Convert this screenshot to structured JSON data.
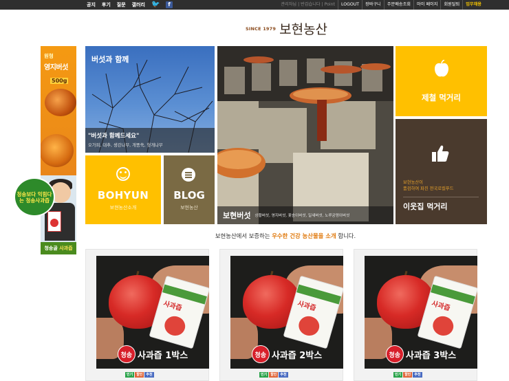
{
  "topnav": {
    "links": [
      "공지",
      "후기",
      "질문",
      "갤러리"
    ],
    "right_links": [
      "관리자님 | 반갑습니다 | Point",
      "LOGOUT",
      "장바구니",
      "주문배송조회",
      "마이 페이지",
      "회원탈퇴",
      "업무채용"
    ]
  },
  "logo": {
    "since": "SINCE 1979",
    "name": "보현농산"
  },
  "left_banner": {
    "tag": "원형",
    "title": "영지버섯",
    "weight": "500g",
    "circle_text": "청송보다 익힘다는 청송사과즙",
    "bottom_label_a": "청송골",
    "bottom_label_b": "사과즙"
  },
  "tiles": {
    "sky": {
      "heading": "버섯과 함께",
      "quote": "\"버섯과 함께드세요\"",
      "sub": "오가피, 대추, 생강나무, 개똥쑥, 헛개나무"
    },
    "bohyun": {
      "title": "BOHYUN",
      "sub": "보현농산소개"
    },
    "blog": {
      "title": "BLOG",
      "sub": "보현농산"
    },
    "main": {
      "title": "보현버섯",
      "sub": "상황버섯, 영지버섯, 꽃송이버섯, 일새버섯, 노루궁뎅이버섯"
    },
    "jechul": {
      "label": "제철 먹거리"
    },
    "neighbor": {
      "small_line1": "보현농산이",
      "small_line2": "품검하여 파진 전국로컬푸드",
      "label": "이웃집 먹거리"
    }
  },
  "promo": {
    "before": "보현농산에서 보증하는 ",
    "highlight": "우수한 건강 농산물을 소개",
    "after": " 합니다."
  },
  "products": [
    {
      "badge": "청송",
      "name": "사과즙 1박스"
    },
    {
      "badge": "청송",
      "name": "사과즙 2박스"
    },
    {
      "badge": "청송",
      "name": "사과즙 3박스"
    }
  ],
  "product_icons": [
    "인기",
    "할인",
    "추천"
  ],
  "colors": {
    "yellow": "#ffc000",
    "brown": "#4a3a2d",
    "olive": "#7a6a44",
    "orange_text": "#e07b10"
  }
}
